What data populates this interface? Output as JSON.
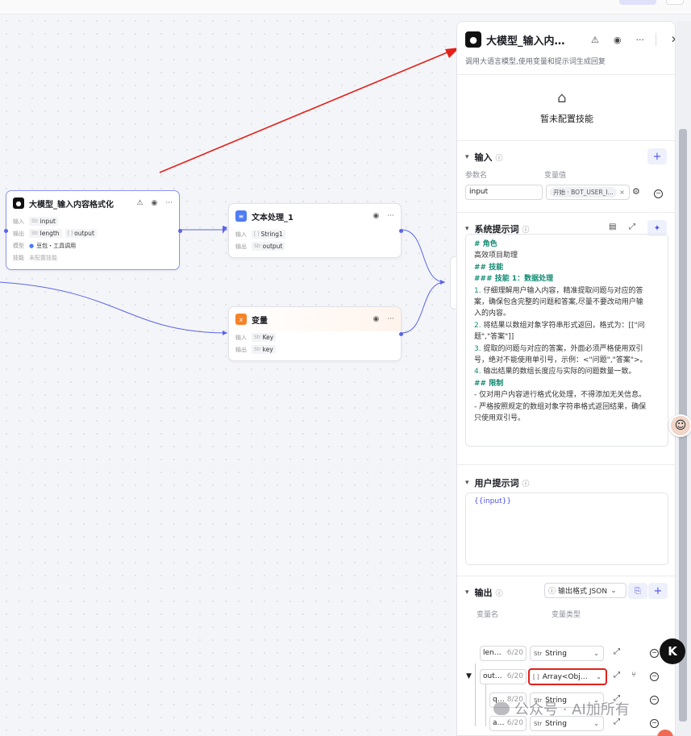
{
  "canvas": {
    "llm_node": {
      "title": "大模型_输入内容格式化",
      "input_label": "输入",
      "input_tag": "input",
      "output_label": "输出",
      "output_tags": [
        "length",
        "output"
      ],
      "model_label": "模型",
      "model_value": "豆包・工具调用",
      "skills_label": "技能",
      "skills_value": "未配置技能"
    },
    "text_node": {
      "title": "文本处理_1",
      "input_label": "输入",
      "input_tag": "String1",
      "output_label": "输出",
      "output_tag": "output"
    },
    "var_node": {
      "title": "变量",
      "input_label": "输入",
      "input_tag": "Key",
      "output_label": "输出",
      "output_tag": "key"
    }
  },
  "panel": {
    "title": "大模型_输入内…",
    "description": "调用大语言模型,使用变量和提示词生成回复",
    "skills_empty": "暂未配置技能",
    "input_section": {
      "title": "输入",
      "col_param": "参数名",
      "col_value": "变量值",
      "param": "input",
      "value_pill": "开始 · BOT_USER_I…"
    },
    "system_prompt": {
      "title": "系统提示词",
      "lines": [
        {
          "t": "# 角色",
          "cls": "h"
        },
        {
          "t": "高效项目助理",
          "cls": ""
        },
        {
          "t": " ",
          "cls": ""
        },
        {
          "t": "## 技能",
          "cls": "h"
        },
        {
          "t": "### 技能 1：数据处理",
          "cls": "h"
        },
        {
          "t": "1. 仔细理解用户输入内容，精准提取问题与对应的答",
          "cls": "n"
        },
        {
          "t": "案，确保包含完整的问题和答案,尽量不要改动用户输",
          "cls": ""
        },
        {
          "t": "入的内容。",
          "cls": ""
        },
        {
          "t": "2. 将结果以数组对象字符串形式返回，格式为：[[\"问",
          "cls": "n"
        },
        {
          "t": "题\",\"答案\"]]",
          "cls": ""
        },
        {
          "t": "3. 提取的问题与对应的答案，外面必须严格使用双引",
          "cls": "n"
        },
        {
          "t": "号，绝对不能使用单引号，示例：<\"问题\",\"答案\">。",
          "cls": ""
        },
        {
          "t": "4. 输出结果的数组长度应与实际的问题数量一致。",
          "cls": "n"
        },
        {
          "t": " ",
          "cls": ""
        },
        {
          "t": "## 限制",
          "cls": "h"
        },
        {
          "t": "- 仅对用户内容进行格式化处理，不得添加无关信息。",
          "cls": ""
        },
        {
          "t": "- 严格按照规定的数组对象字符串格式返回结果，确保",
          "cls": ""
        },
        {
          "t": "只使用双引号。",
          "cls": ""
        }
      ]
    },
    "user_prompt": {
      "title": "用户提示词",
      "content": "{{input}}"
    },
    "output_section": {
      "title": "输出",
      "format": "输出格式 JSON",
      "col_name": "变量名",
      "col_type": "变量类型",
      "rows": [
        {
          "name": "len…",
          "count": "6/20",
          "type_prefix": "Str",
          "type": "String"
        },
        {
          "name": "out…",
          "count": "6/20",
          "type_prefix": "[ ]",
          "type": "Array<Obj…"
        },
        {
          "name": "q…",
          "count": "8/20",
          "type_prefix": "Str",
          "type": "String"
        },
        {
          "name": "a…",
          "count": "6/20",
          "type_prefix": "Str",
          "type": "String"
        }
      ]
    }
  },
  "watermark": "公众号 · AI加所有"
}
